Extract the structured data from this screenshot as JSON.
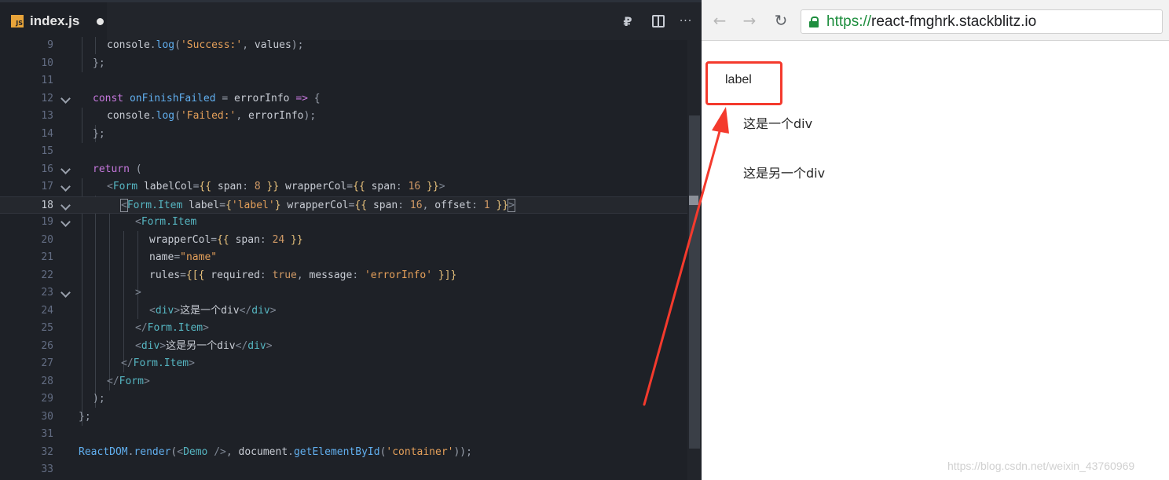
{
  "editor": {
    "tab": {
      "icon_text": "JS",
      "filename": "index.js",
      "icon": "js-file-icon"
    },
    "toolbar": {
      "preview_glyph": "₽",
      "more_glyph": "···",
      "icons": [
        "preview-icon",
        "split-editor-icon",
        "more-icon"
      ]
    },
    "active_line": "18",
    "lines": [
      {
        "n": "9"
      },
      {
        "n": "10"
      },
      {
        "n": "11"
      },
      {
        "n": "12"
      },
      {
        "n": "13"
      },
      {
        "n": "14"
      },
      {
        "n": "15"
      },
      {
        "n": "16"
      },
      {
        "n": "17"
      },
      {
        "n": "18"
      },
      {
        "n": "19"
      },
      {
        "n": "20"
      },
      {
        "n": "21"
      },
      {
        "n": "22"
      },
      {
        "n": "23"
      },
      {
        "n": "24"
      },
      {
        "n": "25"
      },
      {
        "n": "26"
      },
      {
        "n": "27"
      },
      {
        "n": "28"
      },
      {
        "n": "29"
      },
      {
        "n": "30"
      },
      {
        "n": "31"
      },
      {
        "n": "32"
      },
      {
        "n": "33"
      }
    ],
    "tokens": {
      "l9": [
        "console",
        ".",
        "log",
        "(",
        "'Success:'",
        ", ",
        "values",
        ");"
      ],
      "l10": [
        "};"
      ],
      "l12": [
        "const",
        " ",
        "onFinishFailed",
        " = ",
        "errorInfo",
        " ",
        "=>",
        " {"
      ],
      "l13": [
        "console",
        ".",
        "log",
        "(",
        "'Failed:'",
        ", ",
        "errorInfo",
        ");"
      ],
      "l14": [
        "};"
      ],
      "l16": [
        "return",
        " ("
      ],
      "l17": [
        "<",
        "Form",
        " ",
        "labelCol",
        "=",
        "{{",
        " span",
        ": ",
        "8",
        " }}",
        " ",
        "wrapperCol",
        "=",
        "{{",
        " span",
        ": ",
        "16",
        " }}",
        ">"
      ],
      "l18": [
        "<",
        "Form.Item",
        " ",
        "label",
        "=",
        "{",
        "'label'",
        "}",
        " ",
        "wrapperCol",
        "=",
        "{{",
        " span",
        ": ",
        "16",
        ", ",
        "offset",
        ": ",
        "1",
        " }}",
        ">"
      ],
      "l19": [
        "<",
        "Form.Item"
      ],
      "l20": [
        "wrapperCol",
        "=",
        "{{",
        " span",
        ": ",
        "24",
        " }}"
      ],
      "l21": [
        "name",
        "=",
        "\"name\""
      ],
      "l22": [
        "rules",
        "=",
        "{[{",
        " required",
        ": ",
        "true",
        ", ",
        "message",
        ": ",
        "'errorInfo'",
        " }]}"
      ],
      "l23": [
        ">"
      ],
      "l24": [
        "<",
        "div",
        ">",
        "这是一个div",
        "</",
        "div",
        ">"
      ],
      "l25": [
        "</",
        "Form.Item",
        ">"
      ],
      "l26": [
        "<",
        "div",
        ">",
        "这是另一个div",
        "</",
        "div",
        ">"
      ],
      "l27": [
        "</",
        "Form.Item",
        ">"
      ],
      "l28": [
        "</",
        "Form",
        ">"
      ],
      "l29": [
        ");"
      ],
      "l30": [
        "};"
      ],
      "l32": [
        "ReactDOM",
        ".",
        "render",
        "(",
        "<",
        "Demo",
        " />",
        ", ",
        "document",
        ".",
        "getElementById",
        "(",
        "'container'",
        "));"
      ]
    }
  },
  "browser": {
    "nav": {
      "back": "←",
      "forward": "→",
      "reload": "↻"
    },
    "url_scheme": "https://",
    "url_host": "react-fmghrk.stackblitz.io",
    "page": {
      "label": "label",
      "div_1": "这是一个div",
      "div_2": "这是另一个div"
    },
    "watermark": "https://blog.csdn.net/weixin_43760969",
    "annotation_color": "#f43a2d"
  }
}
